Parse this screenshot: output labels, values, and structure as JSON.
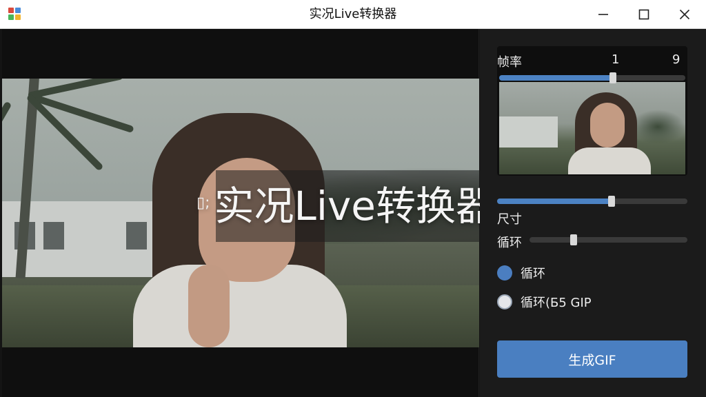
{
  "window": {
    "title": "实况Live转换器",
    "controls": [
      "minimize-icon",
      "maximize-icon",
      "close-icon"
    ]
  },
  "preview": {
    "overlay_title": "实况Live转换器",
    "overlay_glyph": "▯;"
  },
  "panel": {
    "frame_rate": {
      "label": "帧率",
      "value_left": "1",
      "value_right": "9",
      "level": 0.61
    },
    "size": {
      "label": "尺寸",
      "level": 0.6
    },
    "loop": {
      "label": "循环",
      "level": 0.28
    },
    "options": [
      {
        "label": "循环",
        "selected": true
      },
      {
        "label": "循环(Б5 GIP",
        "selected": false
      }
    ],
    "generate_button": "生成GIF"
  },
  "colors": {
    "accent": "#4a7fc1",
    "panel_bg": "#1b1b1b",
    "preview_bg": "#0f0f0f"
  }
}
